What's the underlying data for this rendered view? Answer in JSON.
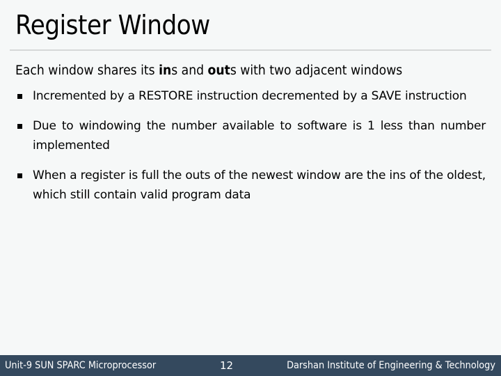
{
  "slide": {
    "title": "Register Window",
    "lead": {
      "part1": "Each window shares its ",
      "bold1": "in",
      "part2": "s and ",
      "bold2": "out",
      "part3": "s with two adjacent windows"
    },
    "bullets": [
      {
        "text": "Incremented by a RESTORE instruction decremented by a SAVE instruction"
      },
      {
        "text": "Due to windowing the number available to software is 1 less than number implemented"
      },
      {
        "text": "When a register is full the outs of the newest window are the ins of the oldest, which still contain valid program data"
      }
    ],
    "bullet_icon": "square-bullet"
  },
  "footer": {
    "course": "Unit-9 SUN SPARC Microprocessor",
    "page_number": "12",
    "institute": "Darshan Institute of Engineering & Technology",
    "background_color": "#34495e"
  }
}
